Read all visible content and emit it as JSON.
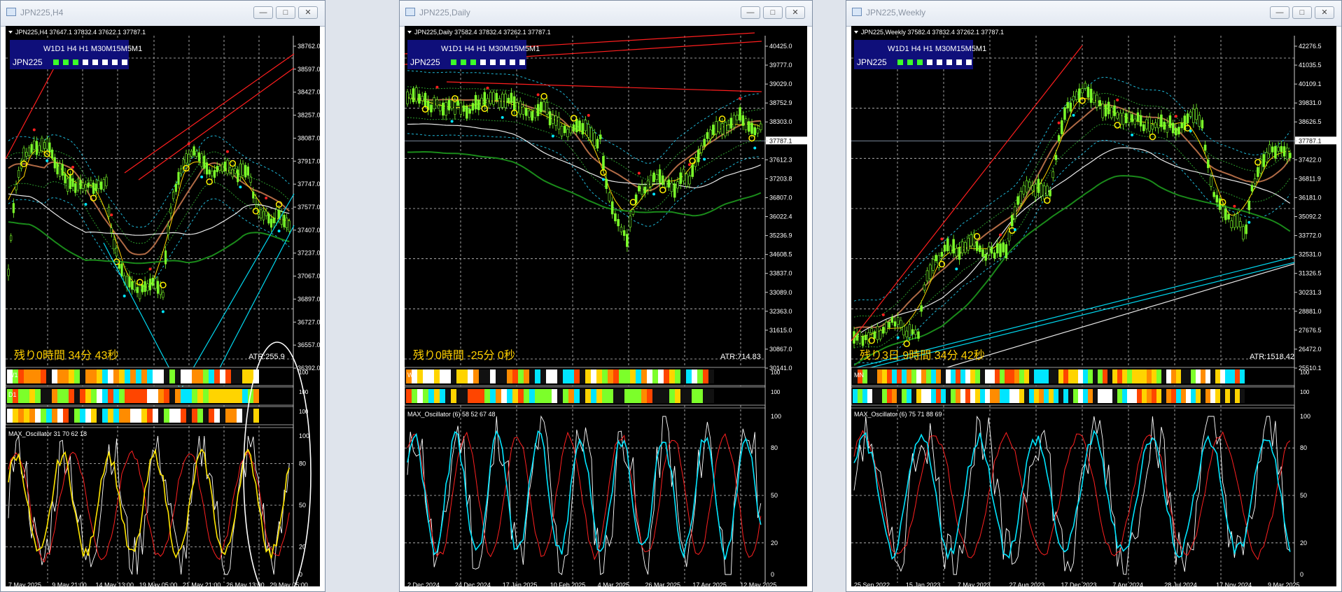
{
  "windows": [
    {
      "id": "h4",
      "title": "JPN225,H4",
      "header": "JPN225,H4  37647.1 37832.4 37622.1 37787.1",
      "panel": {
        "tf": "W1D1 H4 H1 M30M15M5M1",
        "sym": "JPN225"
      },
      "price_labels": [
        "38762.0",
        "38597.0",
        "38427.0",
        "38257.0",
        "38087.0",
        "37917.0",
        "37747.0",
        "37577.0",
        "37407.0",
        "37237.0",
        "37067.0",
        "36897.0",
        "36727.0",
        "36557.0",
        "36392.0"
      ],
      "current_price": "37787.1",
      "countdown": "残り0時間 34分 43秒",
      "atr": "ATR:255.9",
      "bar_labels": [
        "W1",
        "D1",
        ""
      ],
      "osc_label": "MAX_Oscillator 31 70 62 18",
      "osc_levels": [
        "100",
        "80",
        "50",
        "20",
        "0"
      ],
      "dates": [
        "7 May 2025",
        "9 May 21:00",
        "14 May 13:00",
        "19 May 05:00",
        "21 May 21:00",
        "26 May 13:00",
        "29 May 05:00"
      ],
      "window_buttons": [
        "—",
        "□",
        "✕"
      ]
    },
    {
      "id": "daily",
      "title": "JPN225,Daily",
      "header": "JPN225,Daily  37582.4 37832.4 37262.1 37787.1",
      "panel": {
        "tf": "W1D1 H4 H1 M30M15M5M1",
        "sym": "JPN225"
      },
      "price_labels": [
        "40425.0",
        "39777.0",
        "39029.0",
        "38752.9",
        "38303.0",
        "37787.1",
        "37612.3",
        "37203.8",
        "36807.0",
        "36022.4",
        "35236.9",
        "34608.5",
        "33837.0",
        "33089.0",
        "32363.0",
        "31615.0",
        "30867.0",
        "30141.0"
      ],
      "current_price": "37787.1",
      "countdown": "残り0時間 -25分 0秒",
      "atr": "ATR:714.83",
      "bar_labels": [
        "W1",
        ""
      ],
      "osc_label": "MAX_Oscillator (6) 58 52 67 48",
      "osc_levels": [
        "100",
        "80",
        "50",
        "20",
        "0"
      ],
      "dates": [
        "2 Dec 2024",
        "24 Dec 2024",
        "17 Jan 2025",
        "10 Feb 2025",
        "4 Mar 2025",
        "26 Mar 2025",
        "17 Apr 2025",
        "12 May 2025"
      ],
      "window_buttons": [
        "—",
        "□",
        "✕"
      ]
    },
    {
      "id": "weekly",
      "title": "JPN225,Weekly",
      "header": "JPN225,Weekly  37582.4 37832.4 37262.1 37787.1",
      "panel": {
        "tf": "W1D1 H4 H1 M30M15M5M1",
        "sym": "JPN225"
      },
      "price_labels": [
        "42276.5",
        "41035.5",
        "40109.1",
        "39831.0",
        "38626.5",
        "37787.1",
        "37422.0",
        "36811.9",
        "36181.0",
        "35092.2",
        "33772.0",
        "32531.0",
        "31326.5",
        "30231.3",
        "28881.0",
        "27676.5",
        "26472.0",
        "25510.1"
      ],
      "current_price": "37787.1",
      "countdown": "残り3日 9時間 34分 42秒",
      "atr": "ATR:1518.42",
      "bar_labels": [
        "MN",
        ""
      ],
      "osc_label": "MAX_Oscillator (6) 75 71 88 69",
      "osc_levels": [
        "100",
        "80",
        "50",
        "20",
        "0"
      ],
      "dates": [
        "25 Sep 2022",
        "15 Jan 2023",
        "7 May 2023",
        "27 Aug 2023",
        "17 Dec 2023",
        "7 Apr 2024",
        "28 Jul 2024",
        "17 Nov 2024",
        "9 Mar 2025"
      ],
      "window_buttons": [
        "—",
        "□",
        "✕"
      ]
    }
  ],
  "colors": {
    "background": "#000000",
    "candle": "#7cff2a",
    "grid": "#c8c8c8",
    "panel_bg": "#0f0f7a",
    "ma_fast": "#ffd400",
    "ma_slow": "#ff4500",
    "trend_red": "#ff1e1e",
    "trend_cyan": "#00d8f0",
    "osc_white": "#ffffff",
    "osc_red": "#ff2020",
    "osc_cyan": "#00e5ff",
    "osc_orange": "#ff7a00",
    "countdown_text": "#ffd000"
  }
}
